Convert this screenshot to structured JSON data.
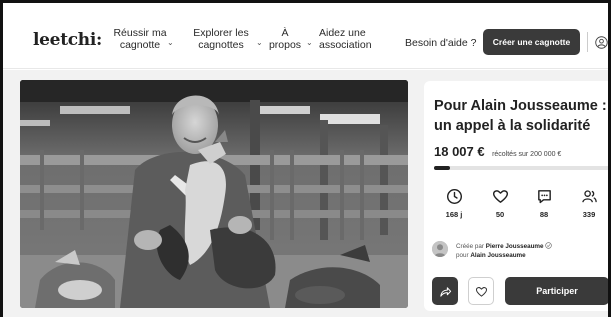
{
  "header": {
    "logo": "leetchi:",
    "nav": [
      {
        "line1": "Réussir ma",
        "line2": "cagnotte"
      },
      {
        "line1": "Explorer les",
        "line2": "cagnottes"
      },
      {
        "line1": "À",
        "line2": "propos"
      },
      {
        "line1": "Aidez une",
        "line2": "association"
      }
    ],
    "help_label": "Besoin d'aide ?",
    "create_label": "Créer une cagnotte"
  },
  "campaign": {
    "title": "Pour Alain Jousseaume : un appel à la solidarité",
    "amount": "18 007 €",
    "goal_text": "récoltés sur 200 000 €",
    "progress_fraction": 0.09,
    "stats": [
      {
        "icon": "clock-icon",
        "value": "168 j"
      },
      {
        "icon": "heart-icon",
        "value": "50"
      },
      {
        "icon": "comment-icon",
        "value": "88"
      },
      {
        "icon": "participants-icon",
        "value": "339"
      }
    ],
    "creator_prefix": "Créée par",
    "creator_name": "Pierre Jousseaume",
    "beneficiary_prefix": "pour",
    "beneficiary_name": "Alain Jousseaume",
    "participate_label": "Participer"
  }
}
